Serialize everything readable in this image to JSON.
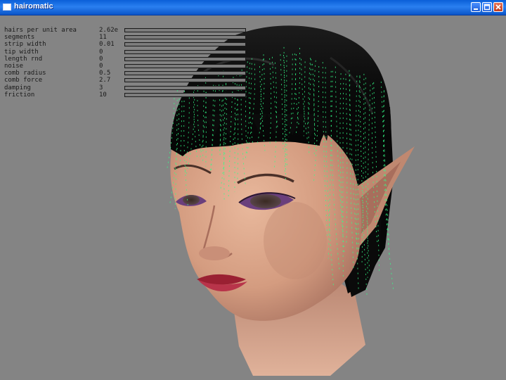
{
  "window": {
    "title": "hairomatic",
    "buttons": {
      "minimize": "minimize-icon",
      "maximize": "maximize-icon",
      "close": "close-icon"
    }
  },
  "colors": {
    "titlebar": "#0a5fd8",
    "background": "#848484",
    "hair": "#0a0a0a",
    "guide_strands": "#33ff88",
    "skin": "#d9a68b",
    "lips": "#a8283c"
  },
  "parameters": [
    {
      "label": "hairs per unit area",
      "value": "2.62e",
      "fill": 0.3
    },
    {
      "label": "segments",
      "value": "11",
      "fill": 0.45
    },
    {
      "label": "strip width",
      "value": "0.01",
      "fill": 0.1
    },
    {
      "label": "tip width",
      "value": "0",
      "fill": 0.0
    },
    {
      "label": "length rnd",
      "value": "0",
      "fill": 0.0
    },
    {
      "label": "noise",
      "value": "0",
      "fill": 0.0
    },
    {
      "label": "comb radius",
      "value": "0.5",
      "fill": 0.5
    },
    {
      "label": "comb force",
      "value": "2.7",
      "fill": 0.55
    },
    {
      "label": "damping",
      "value": "3",
      "fill": 0.3
    },
    {
      "label": "friction",
      "value": "10",
      "fill": 1.0
    }
  ]
}
